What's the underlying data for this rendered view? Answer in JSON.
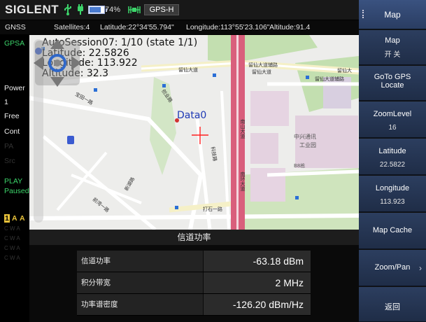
{
  "status_bar": {
    "brand": "SIGLENT",
    "battery_text": "74%",
    "battery_level": 0.74,
    "gps_mode": "GPS-H"
  },
  "gnss_row": {
    "label": "GNSS",
    "satellites": "Satellites:4",
    "latitude": "Latitude:22°34'55.794\"",
    "longitude": "Longitude:113°55'23.106\"",
    "altitude": "Altitude:91.4"
  },
  "left_column": {
    "mode": "GPSA",
    "power_label": "Power",
    "power_value": "1",
    "free": "Free",
    "cont": "Cont",
    "dim1": "PA",
    "dim2": "Src",
    "play": "PLAY",
    "paused": "Paused",
    "trace_num": "1",
    "trace_a1": "A",
    "trace_a2": "A",
    "trace_rows": [
      "C W A",
      "C W A",
      "C W A",
      "C W A"
    ]
  },
  "map": {
    "session_line": "AutoSession07: 1/10 (state 1/1)",
    "latitude_line": "Latitude: 22.5826",
    "longitude_line": "Longitude: 113.922",
    "altitude_line": "Altitude: 32.3",
    "marker_label": "Data0",
    "street_labels": [
      "留仙大道辅路",
      "留仙大道",
      "留仙大道",
      "留仙大",
      "留仙大道辅路",
      "创业路",
      "科技路",
      "宝田一路",
      "新湖路",
      "前湾一路",
      "南山大道",
      "南环大道",
      "打石一路",
      "中兴通讯",
      "工业园",
      "B8栋"
    ]
  },
  "measurement": {
    "title": "信道功率",
    "rows": [
      {
        "label": "信道功率",
        "value": "-63.18 dBm"
      },
      {
        "label": "积分带宽",
        "value": "2 MHz"
      },
      {
        "label": "功率谱密度",
        "value": "-126.20 dBm/Hz"
      }
    ]
  },
  "softkeys": {
    "title": "Map",
    "map_label": "Map",
    "map_sub": "开  关",
    "goto_line1": "GoTo GPS",
    "goto_line2": "Locate",
    "zoom_label": "ZoomLevel",
    "zoom_value": "16",
    "lat_label": "Latitude",
    "lat_value": "22.5822",
    "lon_label": "Longitude",
    "lon_value": "113.923",
    "cache": "Map Cache",
    "zoompan": "Zoom/Pan",
    "back": "返回"
  },
  "colors": {
    "softkey": "#2c3e5f",
    "status_green": "#3cd46a",
    "marker_blue": "#1e39b5",
    "crosshair": "#ff2020"
  }
}
